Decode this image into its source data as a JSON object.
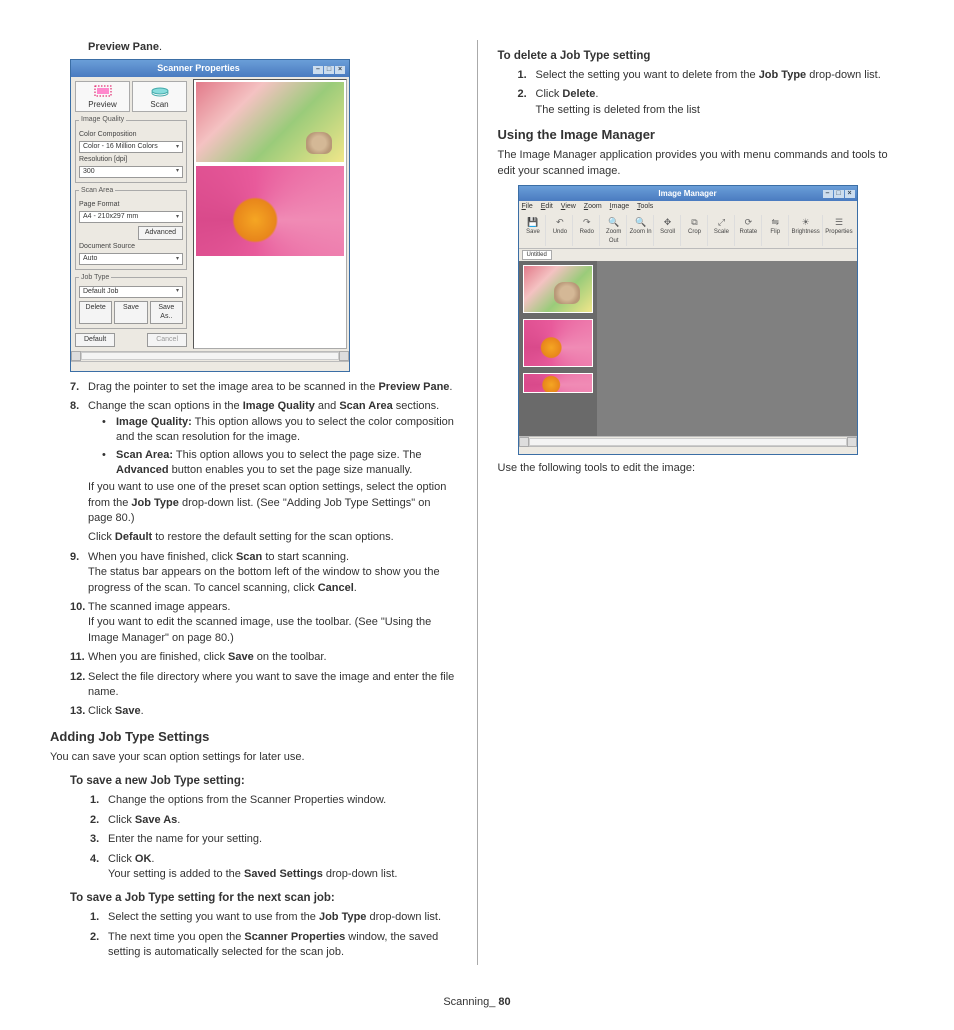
{
  "left": {
    "preview_pane_label": "Preview Pane",
    "step7_a": "Drag the pointer to set the image area to be scanned in the ",
    "step7_b": "Preview Pane",
    "step8_a": "Change the scan options in the ",
    "step8_iq": "Image Quality",
    "step8_and": " and ",
    "step8_sa": "Scan Area",
    "step8_end": " sections.",
    "bullet_iq_label": "Image Quality:",
    "bullet_iq_text": " This option allows you to select the color composition and the scan resolution for the image.",
    "bullet_sa_label": "Scan Area:",
    "bullet_sa_text": " This option allows you to select the page size. The ",
    "bullet_sa_adv": "Advanced",
    "bullet_sa_text2": " button enables you to set the page size manually.",
    "step8_after1_a": "If you want to use one of the preset scan option settings, select the option from the ",
    "step8_after1_b": "Job Type",
    "step8_after1_c": " drop-down list. (See \"Adding Job Type Settings\" on page 80.)",
    "step8_after2_a": "Click ",
    "step8_after2_b": "Default",
    "step8_after2_c": " to restore the default setting for the scan options.",
    "step9_a": "When you have finished, click ",
    "step9_b": "Scan",
    "step9_c": " to start scanning.",
    "step9_after": "The status bar appears on the bottom left of the window to show you the progress of the scan. To cancel scanning, click ",
    "step9_cancel": "Cancel",
    "step10_a": "The scanned image appears.",
    "step10_after": "If you want to edit the scanned image, use the toolbar. (See \"Using the Image Manager\" on page 80.)",
    "step11_a": "When you are finished, click ",
    "step11_b": "Save",
    "step11_c": " on the toolbar.",
    "step12": "Select the file directory where you want to save the image and enter the file name.",
    "step13_a": "Click ",
    "step13_b": "Save",
    "h3_adding": "Adding Job Type Settings",
    "adding_intro": "You can save your scan option settings for later use.",
    "h4_save_new": "To save a new Job Type setting:",
    "sn1": "Change the options from the Scanner Properties window.",
    "sn2_a": "Click ",
    "sn2_b": "Save As",
    "sn3": "Enter the name for your setting.",
    "sn4_a": "Click ",
    "sn4_b": "OK",
    "sn4_after_a": "Your setting is added to the ",
    "sn4_after_b": "Saved Settings",
    "sn4_after_c": " drop-down list.",
    "h4_save_next": "To save a Job Type setting for the next scan job:",
    "sx1_a": "Select the setting you want to use from the ",
    "sx1_b": "Job Type",
    "sx1_c": " drop-down list.",
    "sx2_a": "The next time you open the ",
    "sx2_b": "Scanner Properties",
    "sx2_c": " window, the saved setting is automatically selected for the scan job."
  },
  "right": {
    "h4_delete": "To delete a Job Type setting",
    "d1_a": "Select the setting you want to delete from the ",
    "d1_b": "Job Type",
    "d1_c": " drop-down list.",
    "d2_a": "Click ",
    "d2_b": "Delete",
    "d2_after": "The setting is deleted from the list",
    "h3_im": "Using the Image Manager",
    "im_intro": "The Image Manager application provides you with menu commands and tools to edit your scanned image.",
    "im_after": "Use the following tools to edit the image:"
  },
  "scanner": {
    "title": "Scanner Properties",
    "preview": "Preview",
    "scan": "Scan",
    "grp_iq": "Image Quality",
    "lbl_cc": "Color Composition",
    "val_cc": "Color - 16 Million Colors",
    "lbl_res": "Resolution [dpi]",
    "val_res": "300",
    "grp_sa": "Scan Area",
    "lbl_pf": "Page Format",
    "val_pf": "A4 - 210x297 mm",
    "btn_adv": "Advanced",
    "lbl_ds": "Document Source",
    "val_ds": "Auto",
    "grp_jt": "Job Type",
    "val_jt": "Default Job",
    "btn_delete": "Delete",
    "btn_save": "Save",
    "btn_saveas": "Save As..",
    "btn_default": "Default",
    "btn_cancel": "Cancel"
  },
  "im": {
    "title": "Image Manager",
    "menu": {
      "file": "File",
      "edit": "Edit",
      "view": "View",
      "zoom": "Zoom",
      "image": "Image",
      "tools": "Tools"
    },
    "tools": {
      "save": "Save",
      "undo": "Undo",
      "redo": "Redo",
      "zoomout": "Zoom Out",
      "zoomin": "Zoom In",
      "scroll": "Scroll",
      "crop": "Crop",
      "scale": "Scale",
      "rotate": "Rotate",
      "flip": "Flip",
      "brightness": "Brightness",
      "properties": "Properties"
    },
    "tab": "Untitled"
  },
  "footer": {
    "section": "Scanning",
    "sep": "_ ",
    "page": "80"
  }
}
